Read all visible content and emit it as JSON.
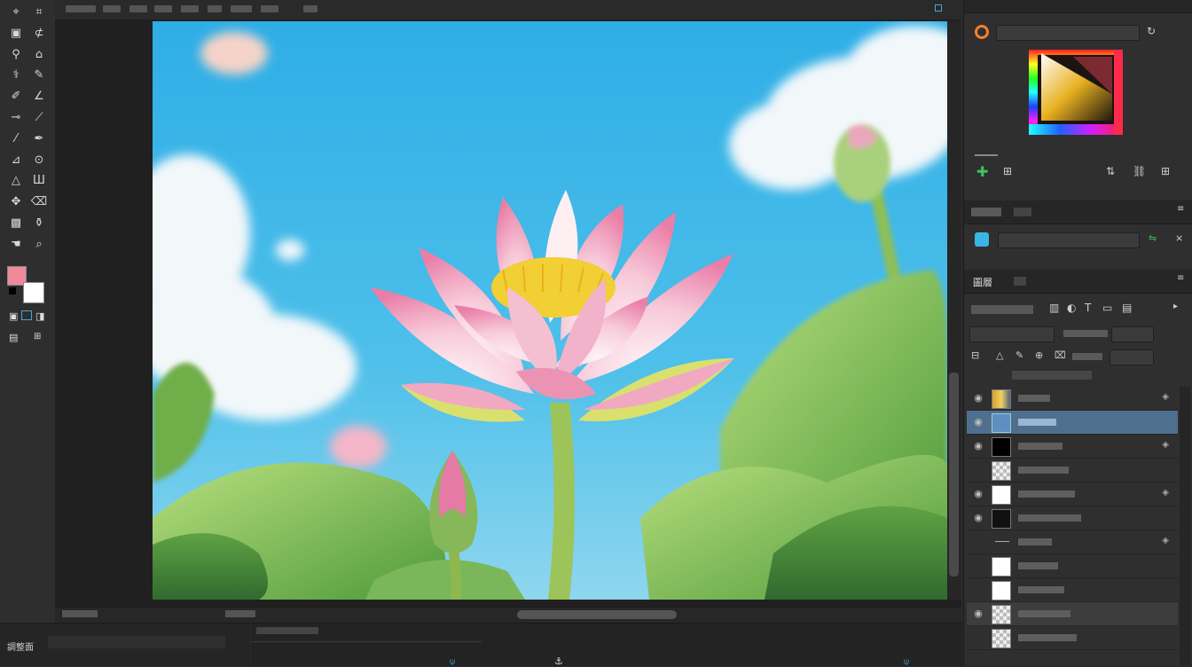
{
  "toolbar": {
    "tools": [
      {
        "name": "lasso-tool-icon",
        "glyph": "⌖"
      },
      {
        "name": "crop-tool-icon",
        "glyph": "⌗"
      },
      {
        "name": "frame-tool-icon",
        "glyph": "▣"
      },
      {
        "name": "polygon-lasso-icon",
        "glyph": "⊄"
      },
      {
        "name": "magic-wand-icon",
        "glyph": "⚲"
      },
      {
        "name": "shape-tool-icon",
        "glyph": "⌂"
      },
      {
        "name": "heal-tool-icon",
        "glyph": "⚕"
      },
      {
        "name": "pencil-tool-icon",
        "glyph": "✎"
      },
      {
        "name": "brush-tool-icon",
        "glyph": "✐"
      },
      {
        "name": "smudge-tool-icon",
        "glyph": "∠"
      },
      {
        "name": "line-tool-icon",
        "glyph": "⊸"
      },
      {
        "name": "eyedropper-icon",
        "glyph": "⟋"
      },
      {
        "name": "blur-tool-icon",
        "glyph": "⁄"
      },
      {
        "name": "pen-tool-icon",
        "glyph": "✒"
      },
      {
        "name": "dodge-tool-icon",
        "glyph": "⊿"
      },
      {
        "name": "burn-tool-icon",
        "glyph": "⊙"
      },
      {
        "name": "path-tool-icon",
        "glyph": "△"
      },
      {
        "name": "type-tool-icon",
        "glyph": "Ш"
      },
      {
        "name": "stamp-tool-icon",
        "glyph": "✥"
      },
      {
        "name": "eraser-tool-icon",
        "glyph": "⌫"
      },
      {
        "name": "gradient-tool-icon",
        "glyph": "▩"
      },
      {
        "name": "bucket-tool-icon",
        "glyph": "⚱"
      },
      {
        "name": "hand-tool-icon",
        "glyph": "☚"
      },
      {
        "name": "zoom-tool-icon",
        "glyph": "⌕"
      }
    ],
    "foreground_color": "#f08a9a",
    "background_color": "#ffffff"
  },
  "bottom_left": {
    "panel_label": "調整面"
  },
  "right_panel": {
    "tabs": {
      "layers": "圖層"
    },
    "colors": {
      "accent_green": "#3fbf5f",
      "selection": "#4f6f8f"
    }
  },
  "layers": [
    {
      "visible": "true",
      "thumb": "gradient",
      "selected": "false"
    },
    {
      "visible": "true",
      "thumb": "blue",
      "selected": "true"
    },
    {
      "visible": "true",
      "thumb": "black",
      "selected": "false"
    },
    {
      "visible": "false",
      "thumb": "checker",
      "selected": "false"
    },
    {
      "visible": "true",
      "thumb": "white",
      "selected": "false"
    },
    {
      "visible": "true",
      "thumb": "dark",
      "selected": "false"
    },
    {
      "visible": "false",
      "thumb": "none",
      "selected": "false"
    },
    {
      "visible": "false",
      "thumb": "white",
      "selected": "false"
    },
    {
      "visible": "false",
      "thumb": "white",
      "selected": "false"
    },
    {
      "visible": "true",
      "thumb": "checker",
      "selected": "false"
    },
    {
      "visible": "false",
      "thumb": "checker",
      "selected": "false"
    }
  ]
}
